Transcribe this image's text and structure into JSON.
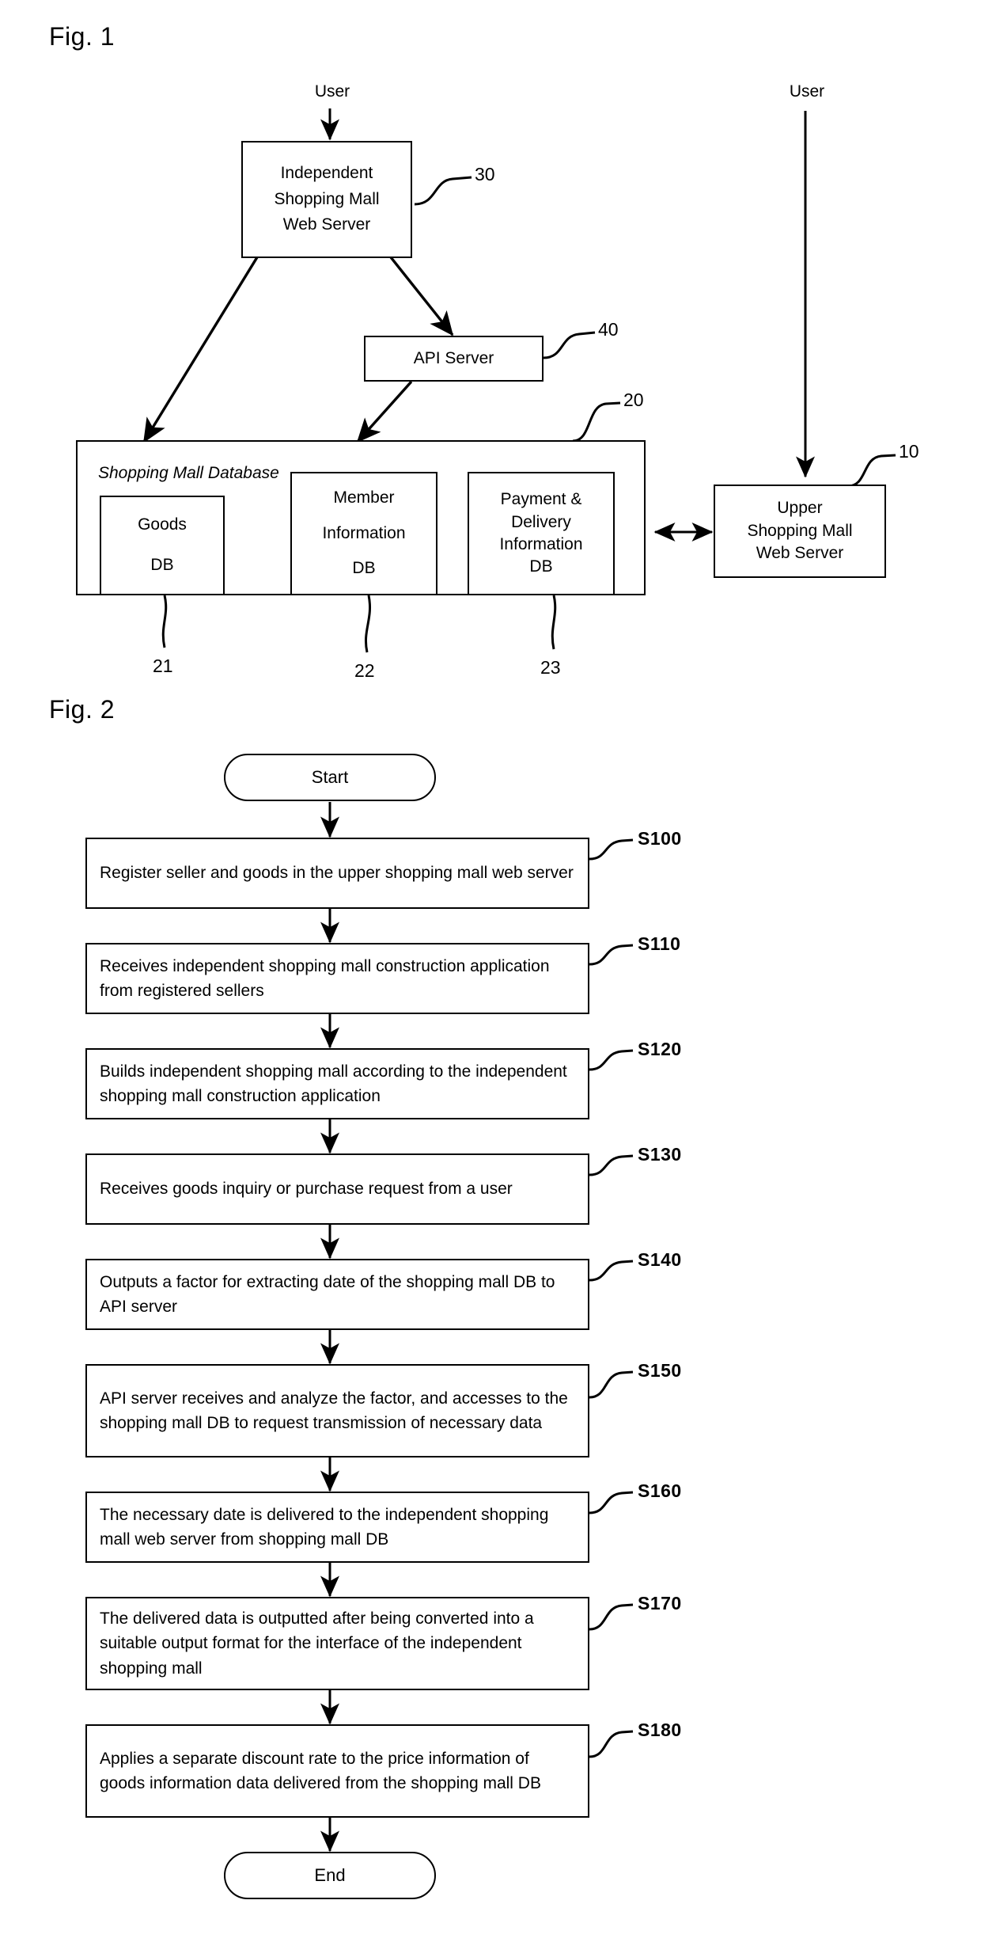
{
  "figures": [
    {
      "id": "fig1",
      "title": "Fig. 1"
    },
    {
      "id": "fig2",
      "title": "Fig. 2"
    }
  ],
  "fig1": {
    "title": "Fig. 1",
    "actors": {
      "user_left": "User",
      "user_right": "User"
    },
    "nodes": {
      "independent_mall_server": {
        "label": "Independent\nShopping Mall\nWeb Server",
        "lines": [
          "Independent",
          "Shopping Mall",
          "Web Server"
        ],
        "ref": "30"
      },
      "api_server": {
        "label": "API Server",
        "ref": "40"
      },
      "shopping_mall_database": {
        "label": "Shopping Mall Database",
        "ref": "20"
      },
      "goods_db": {
        "lines": [
          "Goods",
          "DB"
        ],
        "ref": "21"
      },
      "member_information_db": {
        "lines": [
          "Member",
          "Information",
          "DB"
        ],
        "ref": "22"
      },
      "payment_delivery_db": {
        "lines": [
          "Payment &",
          "Delivery",
          "Information",
          "DB"
        ],
        "ref": "23"
      },
      "upper_mall_server": {
        "lines": [
          "Upper",
          "Shopping Mall",
          "Web Server"
        ],
        "ref": "10"
      }
    }
  },
  "fig2": {
    "title": "Fig. 2",
    "start_label": "Start",
    "end_label": "End",
    "steps": [
      {
        "id": "S100",
        "num": "S100",
        "text": "Register seller and goods in the upper shopping mall web server"
      },
      {
        "id": "S110",
        "num": "S110",
        "text": "Receives independent shopping mall construction application from registered sellers"
      },
      {
        "id": "S120",
        "num": "S120",
        "text": "Builds independent shopping mall according to the independent shopping mall construction application"
      },
      {
        "id": "S130",
        "num": "S130",
        "text": "Receives goods inquiry or purchase request from a user"
      },
      {
        "id": "S140",
        "num": "S140",
        "text": "Outputs a factor for extracting date of the shopping mall DB to API server"
      },
      {
        "id": "S150",
        "num": "S150",
        "text": "API server receives and analyze the factor, and accesses to the shopping mall DB to request transmission of necessary data"
      },
      {
        "id": "S160",
        "num": "S160",
        "text": "The necessary date is delivered to the independent shopping mall web server from shopping mall DB"
      },
      {
        "id": "S170",
        "num": "S170",
        "text": "The delivered data is outputted after being converted into a suitable output format for the interface of the independent shopping mall"
      },
      {
        "id": "S180",
        "num": "S180",
        "text": "Applies a separate discount rate to the price information of goods information data delivered from the shopping mall DB"
      }
    ]
  },
  "colors": {
    "ink": "#000000",
    "paper": "#ffffff"
  }
}
